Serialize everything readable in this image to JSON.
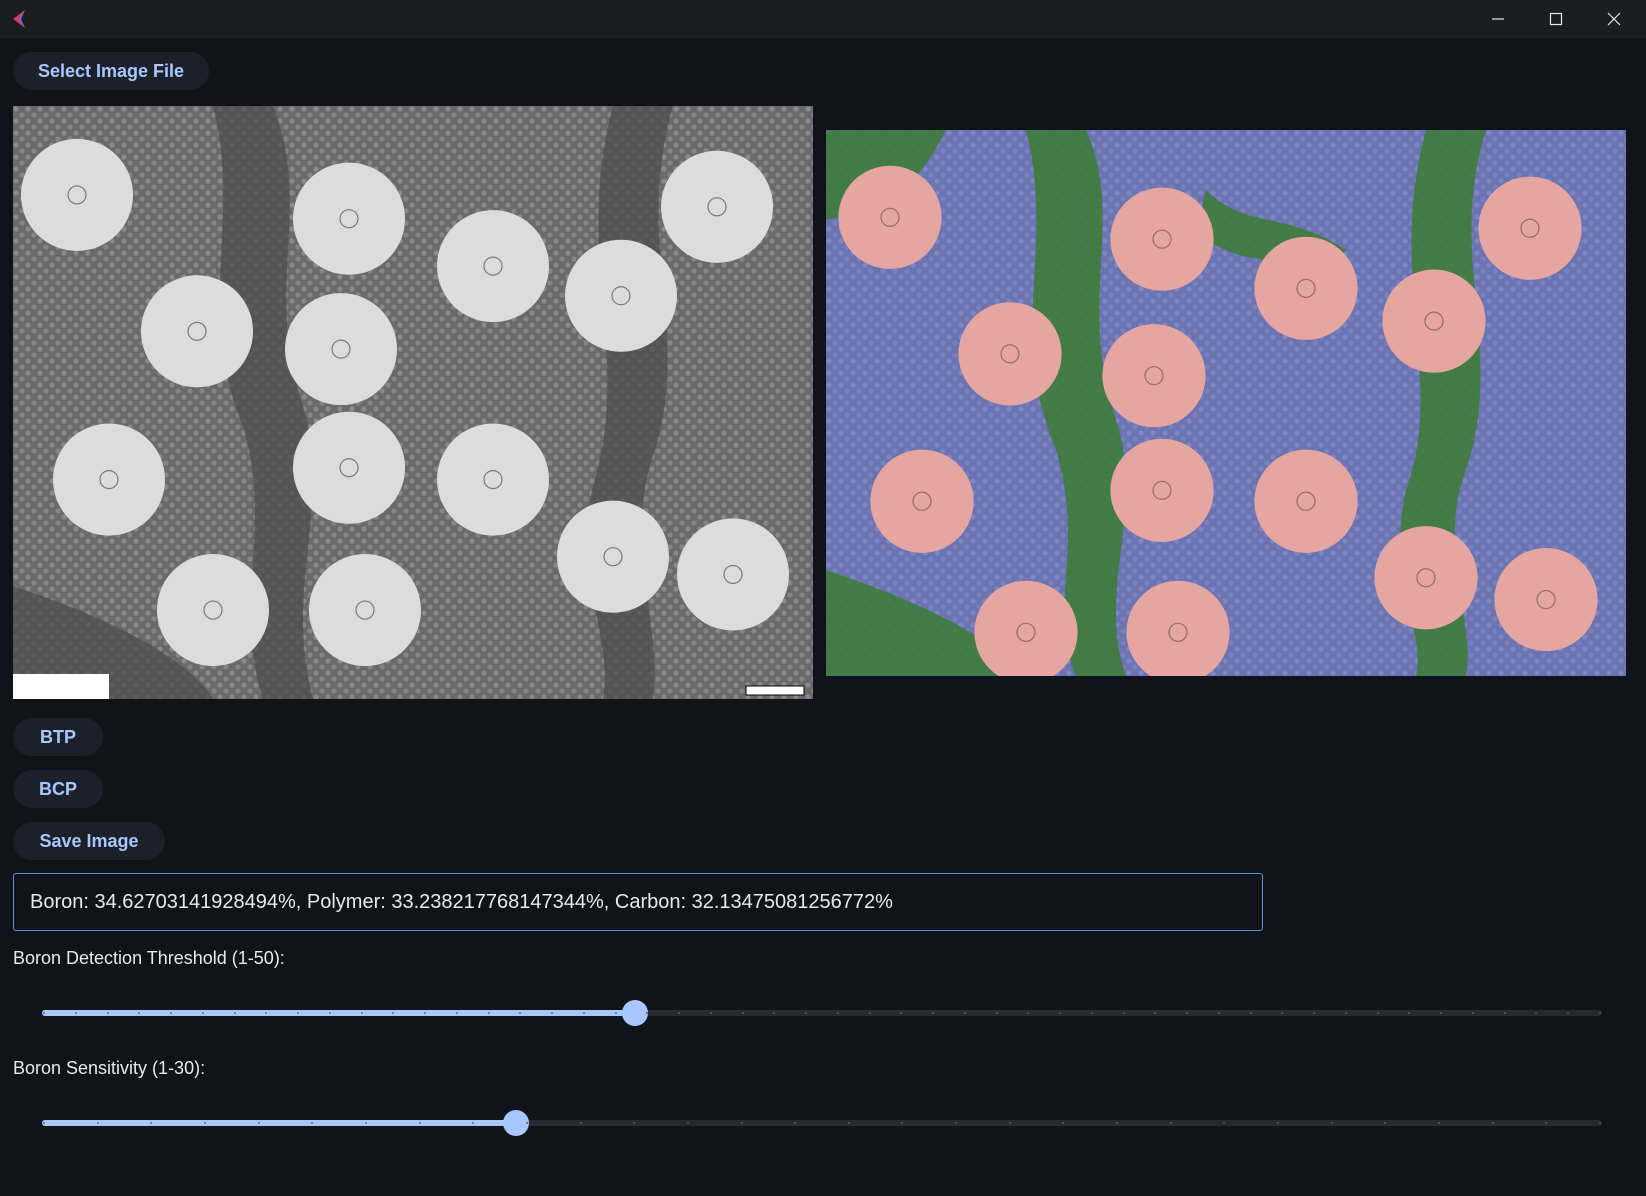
{
  "window": {
    "controls": {
      "minimize_icon": "minimize-icon",
      "maximize_icon": "maximize-icon",
      "close_icon": "close-icon"
    },
    "app_icon_colors": [
      "#e8325a",
      "#3f7ee8"
    ]
  },
  "toolbar": {
    "select_image_label": "Select Image File"
  },
  "actions": {
    "btp_label": "BTP",
    "bcp_label": "BCP",
    "save_label": "Save Image"
  },
  "result": {
    "text": "Boron: 34.62703141928494%, Polymer: 33.238217768147344%, Carbon: 32.13475081256772%"
  },
  "sliders": {
    "threshold": {
      "label": "Boron Detection Threshold (1-50):",
      "min": 1,
      "max": 50,
      "value": 20
    },
    "sensitivity": {
      "label": "Boron Sensitivity (1-30):",
      "min": 1,
      "max": 30,
      "value": 10
    }
  },
  "images": {
    "original": {
      "description_colors": {
        "background": "#6f6f6f",
        "fiber": "#dcdcdc",
        "matrix": "#4a4a4a"
      },
      "circles": [
        [
          0.08,
          0.15,
          0.07
        ],
        [
          0.42,
          0.19,
          0.07
        ],
        [
          0.6,
          0.27,
          0.07
        ],
        [
          0.88,
          0.17,
          0.07
        ],
        [
          0.23,
          0.38,
          0.07
        ],
        [
          0.41,
          0.41,
          0.07
        ],
        [
          0.76,
          0.32,
          0.07
        ],
        [
          0.12,
          0.63,
          0.07
        ],
        [
          0.42,
          0.61,
          0.07
        ],
        [
          0.6,
          0.63,
          0.07
        ],
        [
          0.25,
          0.85,
          0.07
        ],
        [
          0.44,
          0.85,
          0.07
        ],
        [
          0.75,
          0.76,
          0.07
        ],
        [
          0.9,
          0.79,
          0.07
        ]
      ]
    },
    "segmented": {
      "description_colors": {
        "boron": "#e5a5a0",
        "polymer": "#7079b8",
        "carbon": "#3e7c3a"
      },
      "circles": [
        [
          0.08,
          0.16,
          0.07
        ],
        [
          0.42,
          0.2,
          0.07
        ],
        [
          0.6,
          0.29,
          0.07
        ],
        [
          0.88,
          0.18,
          0.07
        ],
        [
          0.23,
          0.41,
          0.07
        ],
        [
          0.41,
          0.45,
          0.07
        ],
        [
          0.76,
          0.35,
          0.07
        ],
        [
          0.12,
          0.68,
          0.07
        ],
        [
          0.42,
          0.66,
          0.07
        ],
        [
          0.6,
          0.68,
          0.07
        ],
        [
          0.25,
          0.92,
          0.07
        ],
        [
          0.44,
          0.92,
          0.07
        ],
        [
          0.75,
          0.82,
          0.07
        ],
        [
          0.9,
          0.86,
          0.07
        ]
      ]
    }
  }
}
